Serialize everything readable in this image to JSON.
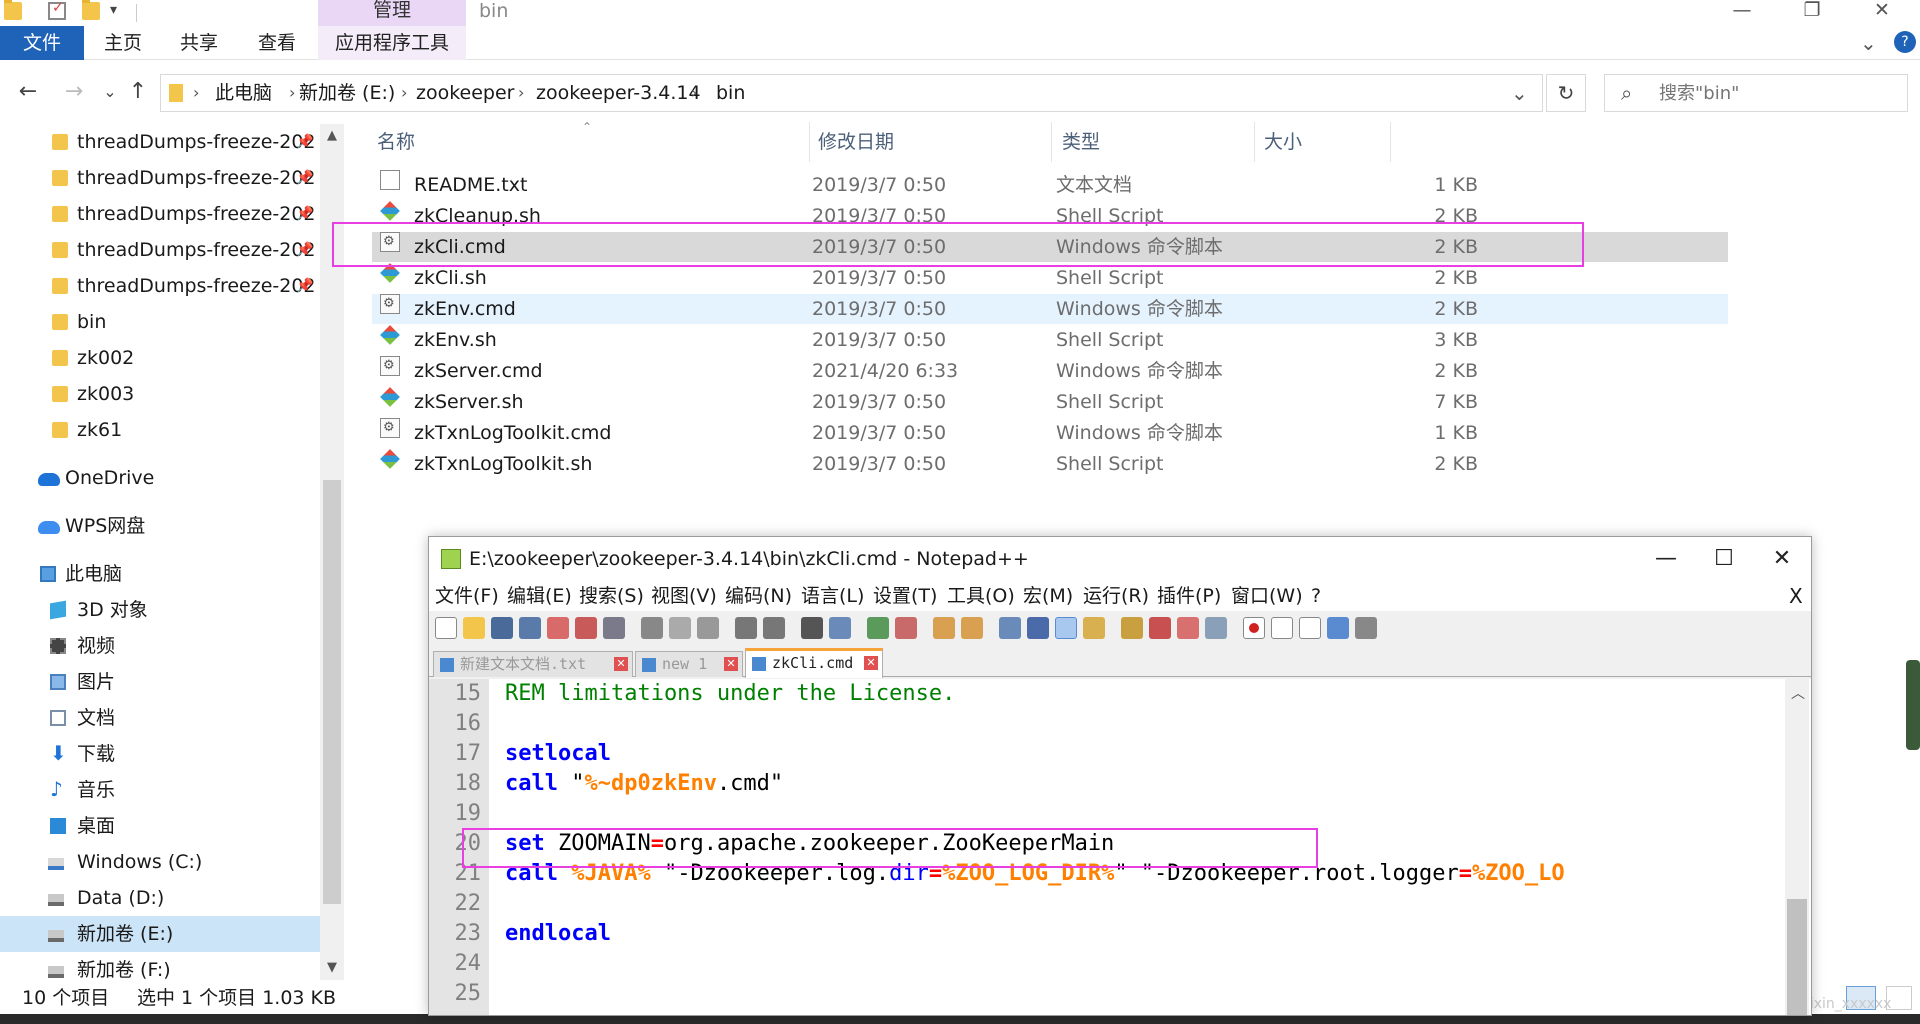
{
  "window": {
    "title": "bin",
    "manage_tab": "管理",
    "minimize": "—",
    "restore": "❐",
    "close": "✕"
  },
  "ribbon": {
    "file": "文件",
    "home": "主页",
    "share": "共享",
    "view": "查看",
    "app_tools": "应用程序工具",
    "expand": "⌄",
    "help": "?"
  },
  "address": {
    "back": "←",
    "forward": "→",
    "recent": "⌄",
    "up": "↑",
    "crumbs": [
      "此电脑",
      "新加卷 (E:)",
      "zookeeper",
      "zookeeper-3.4.14",
      "bin"
    ],
    "dropdown": "⌄",
    "refresh": "↻",
    "search_placeholder": "搜索\"bin\""
  },
  "nav": {
    "items": [
      {
        "label": "threadDumps-freeze-202",
        "pinned": true
      },
      {
        "label": "threadDumps-freeze-202",
        "pinned": true
      },
      {
        "label": "threadDumps-freeze-202",
        "pinned": true
      },
      {
        "label": "threadDumps-freeze-202",
        "pinned": true
      },
      {
        "label": "threadDumps-freeze-202",
        "pinned": true
      },
      {
        "label": "bin"
      },
      {
        "label": "zk002"
      },
      {
        "label": "zk003"
      },
      {
        "label": "zk61"
      },
      {
        "label": "OneDrive"
      },
      {
        "label": "WPS网盘"
      },
      {
        "label": "此电脑"
      },
      {
        "label": "3D 对象"
      },
      {
        "label": "视频"
      },
      {
        "label": "图片"
      },
      {
        "label": "文档"
      },
      {
        "label": "下载"
      },
      {
        "label": "音乐"
      },
      {
        "label": "桌面"
      },
      {
        "label": "Windows (C:)"
      },
      {
        "label": "Data (D:)"
      },
      {
        "label": "新加卷 (E:)"
      },
      {
        "label": "新加卷 (F:)"
      }
    ],
    "pin_glyph": "📌"
  },
  "files": {
    "columns": {
      "name": "名称",
      "date": "修改日期",
      "type": "类型",
      "size": "大小"
    },
    "rows": [
      {
        "name": "README.txt",
        "date": "2019/3/7 0:50",
        "type": "文本文档",
        "size": "1 KB"
      },
      {
        "name": "zkCleanup.sh",
        "date": "2019/3/7 0:50",
        "type": "Shell Script",
        "size": "2 KB"
      },
      {
        "name": "zkCli.cmd",
        "date": "2019/3/7 0:50",
        "type": "Windows 命令脚本",
        "size": "2 KB"
      },
      {
        "name": "zkCli.sh",
        "date": "2019/3/7 0:50",
        "type": "Shell Script",
        "size": "2 KB"
      },
      {
        "name": "zkEnv.cmd",
        "date": "2019/3/7 0:50",
        "type": "Windows 命令脚本",
        "size": "2 KB"
      },
      {
        "name": "zkEnv.sh",
        "date": "2019/3/7 0:50",
        "type": "Shell Script",
        "size": "3 KB"
      },
      {
        "name": "zkServer.cmd",
        "date": "2021/4/20 6:33",
        "type": "Windows 命令脚本",
        "size": "2 KB"
      },
      {
        "name": "zkServer.sh",
        "date": "2019/3/7 0:50",
        "type": "Shell Script",
        "size": "7 KB"
      },
      {
        "name": "zkTxnLogToolkit.cmd",
        "date": "2019/3/7 0:50",
        "type": "Windows 命令脚本",
        "size": "1 KB"
      },
      {
        "name": "zkTxnLogToolkit.sh",
        "date": "2019/3/7 0:50",
        "type": "Shell Script",
        "size": "2 KB"
      }
    ]
  },
  "status": {
    "count": "10 个项目",
    "selection": "选中 1 个项目  1.03 KB"
  },
  "npp": {
    "title": "E:\\zookeeper\\zookeeper-3.4.14\\bin\\zkCli.cmd - Notepad++",
    "minimize": "—",
    "maximize": "☐",
    "close": "✕",
    "menu": [
      "文件(F)",
      "编辑(E)",
      "搜索(S)",
      "视图(V)",
      "编码(N)",
      "语言(L)",
      "设置(T)",
      "工具(O)",
      "宏(M)",
      "运行(R)",
      "插件(P)",
      "窗口(W)",
      "?"
    ],
    "close_doc": "X",
    "tabs": [
      "新建文本文档.txt",
      "new 1",
      "zkCli.cmd"
    ],
    "line_numbers": [
      "15",
      "16",
      "17",
      "18",
      "19",
      "20",
      "21",
      "22",
      "23",
      "24",
      "25"
    ],
    "code": {
      "l15": "REM limitations under the License.",
      "l17_kw": "setlocal",
      "l18_kw": "call",
      "l18_q1": "\"",
      "l18_var": "%~dp0zkEnv",
      "l18_rest": ".cmd\"",
      "l20_kw": "set",
      "l20_name": " ZOOMAIN",
      "l20_op": "=",
      "l20_val": "org.apache.zookeeper.ZooKeeperMain",
      "l21_kw": "call",
      "l21_var1": " %JAVA%",
      "l21_s1": " \"-Dzookeeper.log.",
      "l21_dir": "dir",
      "l21_op1": "=",
      "l21_var2": "%ZOO_LOG_DIR%",
      "l21_s2": "\" \"-Dzookeeper.root.logger",
      "l21_op2": "=",
      "l21_var3": "%ZOO_LO",
      "l23_kw": "endlocal"
    }
  },
  "watermark": "https://blog.csdn.net/weixin_xxxxxx"
}
